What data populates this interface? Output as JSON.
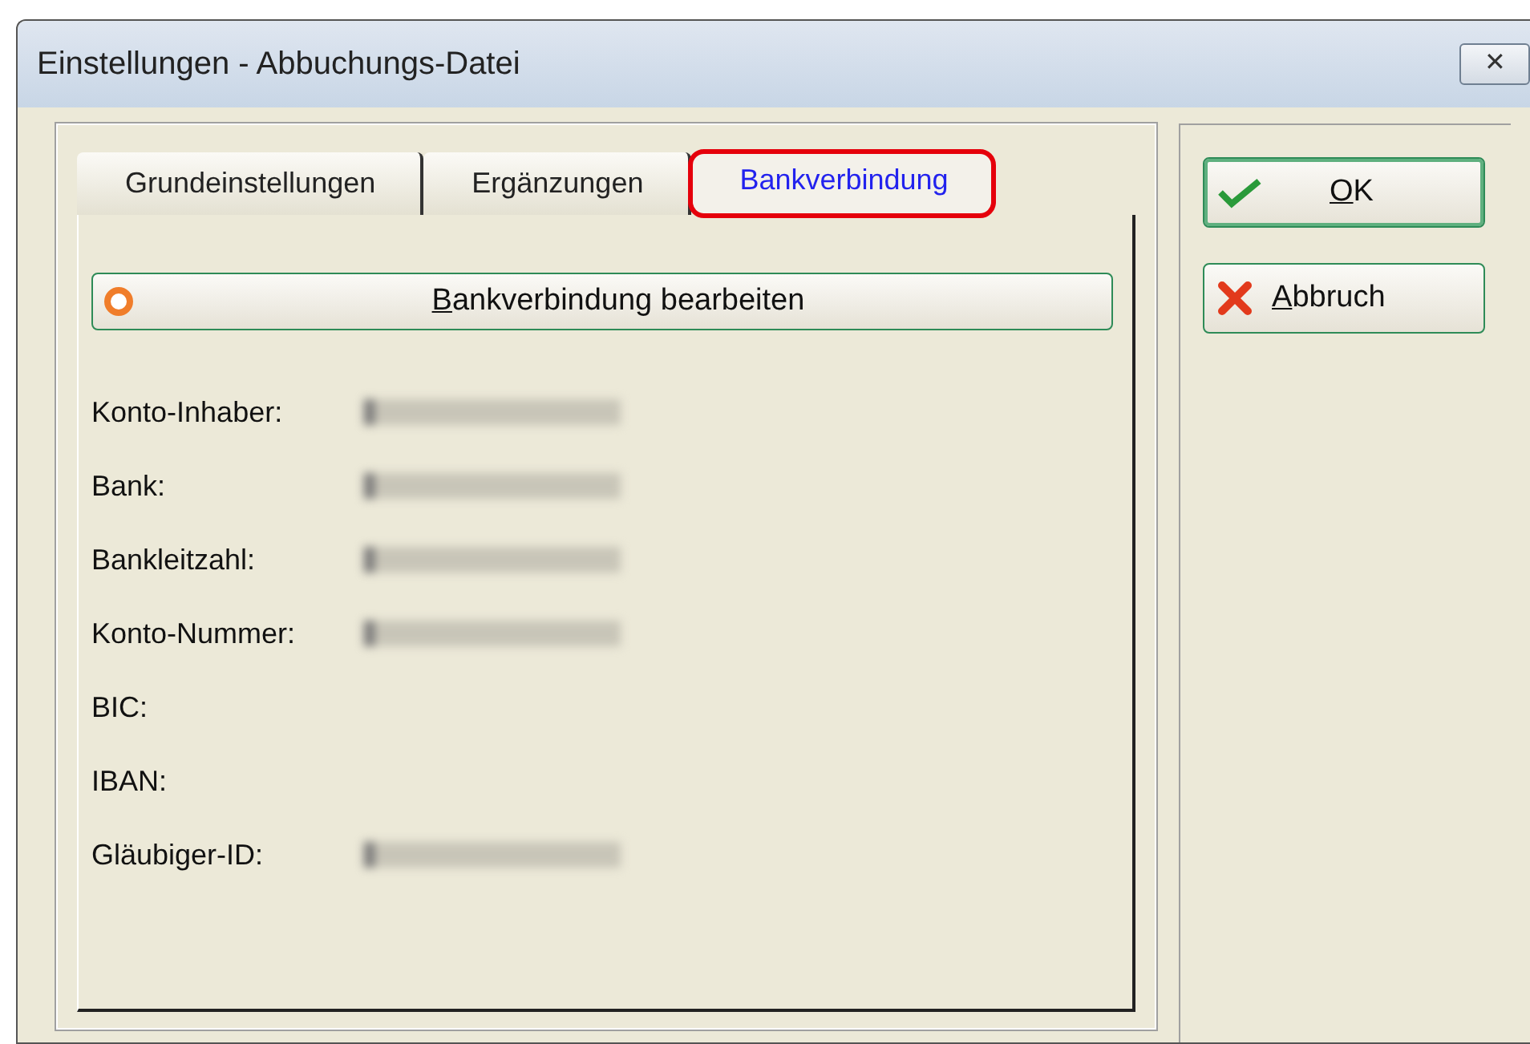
{
  "window": {
    "title": "Einstellungen - Abbuchungs-Datei",
    "close_glyph": "✕"
  },
  "tabs": [
    {
      "label": "Grundeinstellungen",
      "selected": false,
      "highlighted": false
    },
    {
      "label": "Ergänzungen",
      "selected": false,
      "highlighted": false
    },
    {
      "label": "Bankverbindung",
      "selected": true,
      "highlighted": true
    }
  ],
  "edit_button": {
    "label": "Bankverbindung bearbeiten",
    "underline_first": true
  },
  "fields": [
    {
      "label": "Konto-Inhaber:",
      "value_blurred": true
    },
    {
      "label": "Bank:",
      "value_blurred": true
    },
    {
      "label": "Bankleitzahl:",
      "value_blurred": true
    },
    {
      "label": "Konto-Nummer:",
      "value_blurred": true
    },
    {
      "label": "BIC:",
      "value_blurred": false
    },
    {
      "label": "IBAN:",
      "value_blurred": false
    },
    {
      "label": "Gläubiger-ID:",
      "value_blurred": true
    }
  ],
  "buttons": [
    {
      "kind": "ok",
      "label": "OK",
      "underline_first": true
    },
    {
      "kind": "cancel",
      "label": "Abbruch",
      "underline_first": true
    }
  ]
}
